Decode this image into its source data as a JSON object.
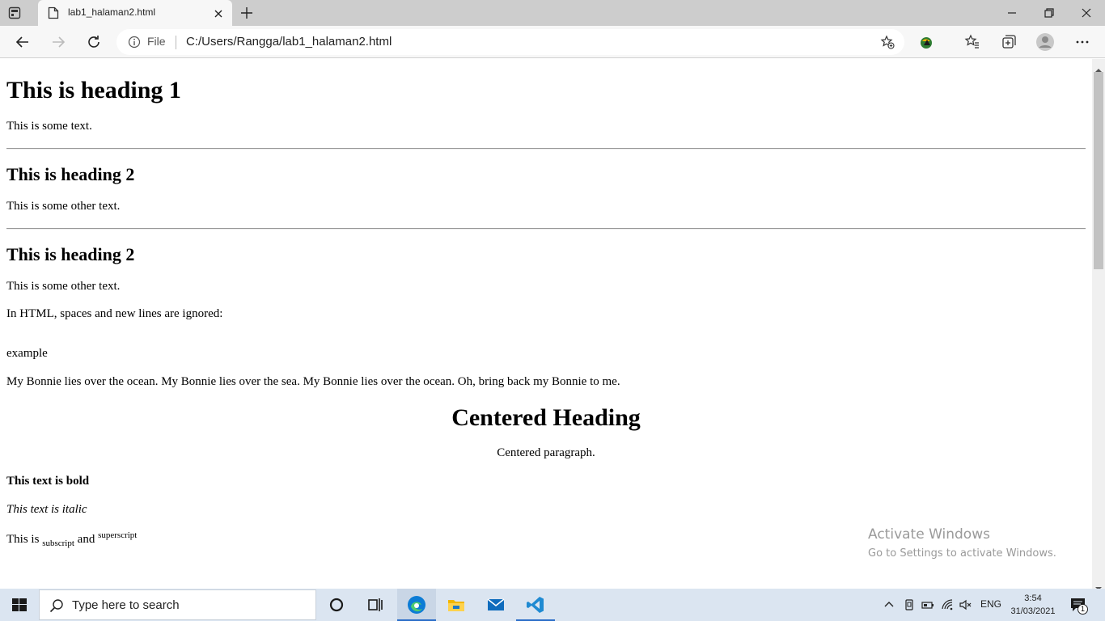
{
  "browser": {
    "tab": {
      "title": "lab1_halaman2.html"
    },
    "address": {
      "scheme_label": "File",
      "url": "C:/Users/Rangga/lab1_halaman2.html"
    }
  },
  "page": {
    "h1": "This is heading 1",
    "p1": "This is some text.",
    "h2a": "This is heading 2",
    "p2": "This is some other text.",
    "h2b": "This is heading 2",
    "p3": "This is some other text.",
    "p4": "In HTML, spaces and new lines are ignored:",
    "p5": "example",
    "p6": "My Bonnie lies over the ocean. My Bonnie lies over the sea. My Bonnie lies over the ocean. Oh, bring back my Bonnie to me.",
    "centered_heading": "Centered Heading",
    "centered_paragraph": "Centered paragraph.",
    "bold_text": "This text is bold",
    "italic_text": "This text is italic",
    "sub_prefix": "This is",
    "subscript": "subscript",
    "and_word": "and",
    "superscript": "superscript"
  },
  "watermark": {
    "title": "Activate Windows",
    "subtitle": "Go to Settings to activate Windows."
  },
  "taskbar": {
    "search_placeholder": "Type here to search",
    "language": "ENG",
    "time": "3:54",
    "date": "31/03/2021",
    "notification_count": "1"
  },
  "colors": {
    "accent": "#2b6ec8",
    "taskbar": "#dbe5f1",
    "tabstrip": "#cdcdcd"
  }
}
